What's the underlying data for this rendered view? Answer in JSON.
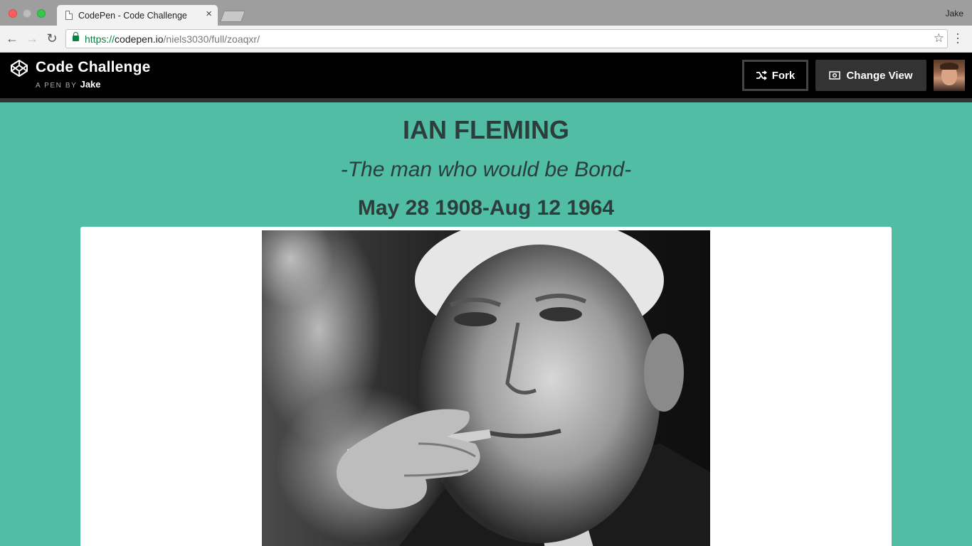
{
  "browser": {
    "tab_title": "CodePen - Code Challenge",
    "tab_close": "×",
    "profile_name": "Jake",
    "url_scheme": "https://",
    "url_host": "codepen.io",
    "url_path": "/niels3030/full/zoaqxr/",
    "icons": [
      "back-arrow-icon",
      "forward-arrow-icon",
      "reload-icon",
      "lock-icon",
      "star-icon",
      "menu-icon",
      "page-icon"
    ]
  },
  "codepen": {
    "pen_title": "Code Challenge",
    "byline_prefix": "A PEN BY",
    "author": "Jake",
    "fork_label": "Fork",
    "change_view_label": "Change View"
  },
  "page": {
    "name": "IAN FLEMING",
    "tagline": "-The man who would be Bond-",
    "dates": "May 28 1908-Aug 12 1964"
  },
  "colors": {
    "page_background": "#52bda5",
    "header_background": "#000000",
    "heading_text": "#2c3e3b"
  }
}
